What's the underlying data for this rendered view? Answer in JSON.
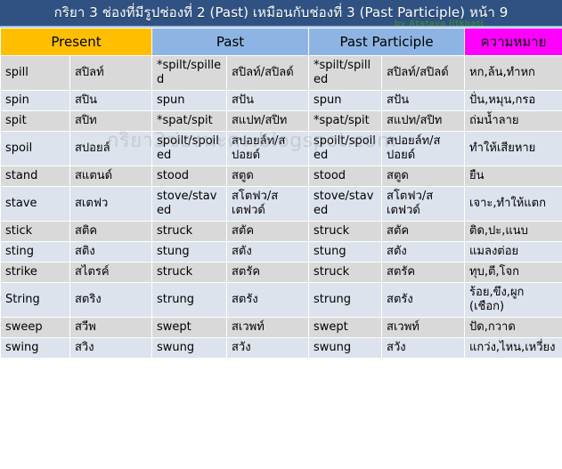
{
  "header": {
    "title": "กริยา 3 ช่องที่มีรูปช่องที่ 2 (Past) เหมือนกับช่องที่ 3 (Past Participle) หน้า 9",
    "byline": "by Atataya Jitkhati",
    "title_bg": "#2f5282",
    "title_color": "#ffffff"
  },
  "watermark": {
    "text": "กริยา3ช่องนะคะ.blogspot.com"
  },
  "columns": {
    "present": "Present",
    "past": "Past",
    "past_participle": "Past Participle",
    "meaning": "ความหมาย",
    "colors": {
      "present_bg": "#ffbf00",
      "past_bg": "#8eb4e3",
      "pp_bg": "#8eb4e3",
      "meaning_bg": "#ff00ff",
      "row_gray": "#d9d9d9",
      "row_blue": "#dce3ec",
      "verb_blue": "#2ea8e8"
    }
  },
  "rows": [
    {
      "present_en": "spill",
      "present_th": "สปิลท์",
      "past_en": "*spilt/spilled",
      "past_th": "สปิลท์/สปิลด์",
      "pp_en": "*spilt/spilled",
      "pp_th": "สปิลท์/สปิลด์",
      "meaning": "หก,ล้น,ทำหก"
    },
    {
      "present_en": "spin",
      "present_th": "สปิน",
      "past_en": "spun",
      "past_th": "สปัน",
      "pp_en": "spun",
      "pp_th": "สปัน",
      "meaning": "ปั่น,หมุน,กรอ"
    },
    {
      "present_en": "spit",
      "present_th": "สปิท",
      "past_en": "*spat/spit",
      "past_th": "สแปท/สปิท",
      "pp_en": "*spat/spit",
      "pp_th": "สแปท/สปิท",
      "meaning": "ถ่มน้ำลาย"
    },
    {
      "present_en": "spoil",
      "present_th": "สปอยล์",
      "past_en": "spoilt/spoiled",
      "past_th": "สปอยล์ท/สปอยด์",
      "pp_en": "spoilt/spoiled",
      "pp_th": "สปอยล์ท/สปอยด์",
      "meaning": "ทำให้เสียหาย"
    },
    {
      "present_en": "stand",
      "present_th": "สแตนด์",
      "past_en": "stood",
      "past_th": "สตูด",
      "pp_en": "stood",
      "pp_th": "สตูด",
      "meaning": "ยืน"
    },
    {
      "present_en": "stave",
      "present_th": "สเตฟว",
      "past_en": "stove/staved",
      "past_th": "สโตฟว/สเตฟวด์",
      "pp_en": "stove/staved",
      "pp_th": "สโตฟว/สเตฟวด์",
      "meaning": "เจาะ,ทำให้แตก"
    },
    {
      "present_en": "stick",
      "present_th": "สติค",
      "past_en": "struck",
      "past_th": "สตัค",
      "pp_en": "struck",
      "pp_th": "สตัค",
      "meaning": "ติด,ปะ,แนบ"
    },
    {
      "present_en": "sting",
      "present_th": "สติง",
      "past_en": "stung",
      "past_th": "สตัง",
      "pp_en": "stung",
      "pp_th": "สตัง",
      "meaning": "แมลงต่อย"
    },
    {
      "present_en": "strike",
      "present_th": "สไตรค์",
      "past_en": "struck",
      "past_th": "สตรัค",
      "pp_en": "struck",
      "pp_th": "สตรัค",
      "meaning": "ทุบ,ตี,โจก"
    },
    {
      "present_en": "String",
      "present_th": "สตริง",
      "past_en": "strung",
      "past_th": "สตรัง",
      "pp_en": "strung",
      "pp_th": "สตรัง",
      "meaning": "ร้อย,ขึง,ผูก (เชือก)"
    },
    {
      "present_en": "sweep",
      "present_th": "สวีพ",
      "past_en": "swept",
      "past_th": "สเวพท์",
      "pp_en": "swept",
      "pp_th": "สเวพท์",
      "meaning": "ปัด,กวาด"
    },
    {
      "present_en": "swing",
      "present_th": "สวิง",
      "past_en": "swung",
      "past_th": "สวัง",
      "pp_en": "swung",
      "pp_th": "สวัง",
      "meaning": "แกว่ง,ไหน,เหวี่ยง"
    }
  ]
}
